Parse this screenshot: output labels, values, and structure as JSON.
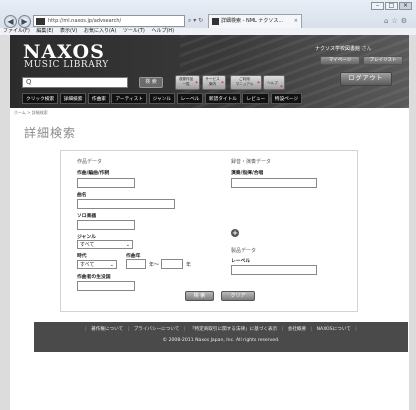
{
  "browser": {
    "address": "http://ml.naxos.jp/advsearch/",
    "address_host": "naxos.jp",
    "tab_title": "詳細検索 - NML ナクソス...",
    "tab_close": "×",
    "menu": [
      "ファイル(F)",
      "編集(E)",
      "表示(V)",
      "お気に入り(A)",
      "ツール(T)",
      "ヘルプ(H)"
    ],
    "back_icon": "arrow-left",
    "forward_icon": "arrow-right"
  },
  "header": {
    "logo_main": "NAXOS",
    "logo_sub": "MUSIC LIBRARY",
    "search_glyph": "Q",
    "search_button": "検 索",
    "buttons": [
      {
        "label": "収録作品\n一覧"
      },
      {
        "label": "サービス\n案内"
      },
      {
        "label": "ご利用\nマニュアル"
      },
      {
        "label": "ヘルプ"
      }
    ],
    "welcome_text": "ナクソス学校図書館",
    "welcome_suffix": "さん",
    "side_button_1": "マイページ",
    "side_button_2": "プレイリスト",
    "logout": "ログアウト",
    "nav": [
      "クリック検索",
      "詳細検索",
      "作曲家",
      "アーティスト",
      "ジャンル",
      "レーベル",
      "新譜タイトル",
      "レビュー",
      "特設ページ"
    ]
  },
  "content": {
    "breadcrumb": "ホーム > 詳細検索",
    "title": "詳細検索",
    "sections": {
      "work": "作品データ",
      "recording": "録音・演奏データ",
      "product": "製品データ"
    },
    "labels": {
      "composer": "作曲/編曲/作詞",
      "work_title": "曲名",
      "opus": "ソロ楽器",
      "genre": "ジャンル",
      "era": "時代",
      "year": "作曲年",
      "birthplace": "作曲者の生没国",
      "performer": "演奏/指揮/合唱",
      "label": "レーベル"
    },
    "genre_value": "すべて",
    "era_value": "すべて",
    "year_from_suffix": "年〜",
    "year_to_suffix": "年",
    "add_glyph": "+",
    "search_button": "検 索",
    "clear_button": "クリア"
  },
  "footer": {
    "links": [
      "著作権について",
      "プライバシーについて",
      "「特定商取引に関する法律」に基づく表示",
      "会社概要",
      "NAXOSについて"
    ],
    "copyright": "© 2008-2011 Naxos Japan, Inc. All rights reserved."
  }
}
